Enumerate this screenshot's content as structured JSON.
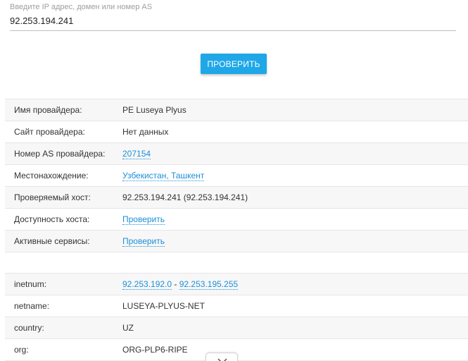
{
  "search": {
    "label": "Введите IP адрес, домен или номер AS",
    "value": "92.253.194.241"
  },
  "check_button": {
    "label": "ПРОВЕРИТЬ"
  },
  "provider_info": {
    "rows": [
      {
        "label": "Имя провайдера:",
        "value": "PE Luseya Plyus"
      },
      {
        "label": "Сайт провайдера:",
        "value": "Нет данных"
      },
      {
        "label": "Номер AS провайдера:",
        "value": "207154"
      },
      {
        "label": "Местонахождение:",
        "value": "Узбекистан, Ташкент"
      },
      {
        "label": "Проверяемый хост:",
        "value": "92.253.194.241 (92.253.194.241)"
      },
      {
        "label": "Доступность хоста:",
        "value": "Проверить"
      },
      {
        "label": "Активные сервисы:",
        "value": "Проверить"
      }
    ]
  },
  "whois": {
    "rows": [
      {
        "label": "inetnum:",
        "range_start": "92.253.192.0",
        "separator": " - ",
        "range_end": "92.253.195.255"
      },
      {
        "label": "netname:",
        "value": "LUSEYA-PLYUS-NET"
      },
      {
        "label": "country:",
        "value": "UZ"
      },
      {
        "label": "org:",
        "value": "ORG-PLP6-RIPE"
      }
    ]
  },
  "icons": {
    "scroll_toggle": "chevron-down-icon"
  },
  "colors": {
    "accent": "#1fa7e8",
    "link": "#1c8fd8",
    "row_stripe": "#f7f7f7",
    "border": "#e6e6e6"
  }
}
